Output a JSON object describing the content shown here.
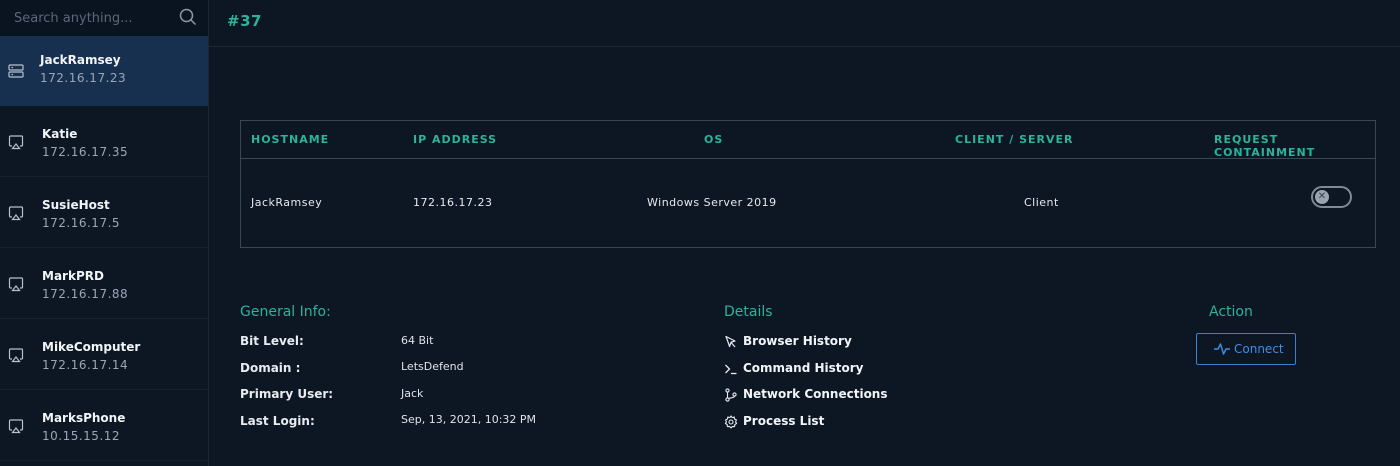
{
  "search": {
    "placeholder": "Search anything..."
  },
  "hosts": [
    {
      "name": "JackRamsey",
      "ip": "172.16.17.23",
      "icon": "server-icon",
      "active": true
    },
    {
      "name": "Katie",
      "ip": "172.16.17.35",
      "icon": "monitor-icon"
    },
    {
      "name": "SusieHost",
      "ip": "172.16.17.5",
      "icon": "monitor-icon"
    },
    {
      "name": "MarkPRD",
      "ip": "172.16.17.88",
      "icon": "monitor-icon"
    },
    {
      "name": "MikeComputer",
      "ip": "172.16.17.14",
      "icon": "monitor-icon"
    },
    {
      "name": "MarksPhone",
      "ip": "10.15.15.12",
      "icon": "monitor-icon"
    }
  ],
  "header": {
    "title": "#37"
  },
  "table": {
    "columns": [
      "HOSTNAME",
      "IP ADDRESS",
      "OS",
      "CLIENT / SERVER",
      "REQUEST CONTAINMENT"
    ],
    "row": {
      "hostname": "JackRamsey",
      "ip": "172.16.17.23",
      "os": "Windows Server 2019",
      "type": "Client",
      "containment": false
    }
  },
  "general_info": {
    "title": "General Info:",
    "items": [
      {
        "label": "Bit Level:",
        "value": "64 Bit"
      },
      {
        "label": "Domain :",
        "value": "LetsDefend"
      },
      {
        "label": "Primary User:",
        "value": "Jack"
      },
      {
        "label": "Last Login:",
        "value": "Sep, 13, 2021, 10:32 PM"
      }
    ]
  },
  "details": {
    "title": "Details",
    "items": [
      {
        "label": "Browser History",
        "icon": "cursor-icon"
      },
      {
        "label": "Command History",
        "icon": "terminal-icon"
      },
      {
        "label": "Network Connections",
        "icon": "git-branch-icon"
      },
      {
        "label": "Process List",
        "icon": "gear-icon"
      }
    ]
  },
  "action": {
    "title": "Action",
    "connect_label": "Connect"
  },
  "colors": {
    "accent": "#2bb39b",
    "active_bg": "#18304f",
    "link_blue": "#3f8ee6",
    "background": "#0d1623"
  }
}
